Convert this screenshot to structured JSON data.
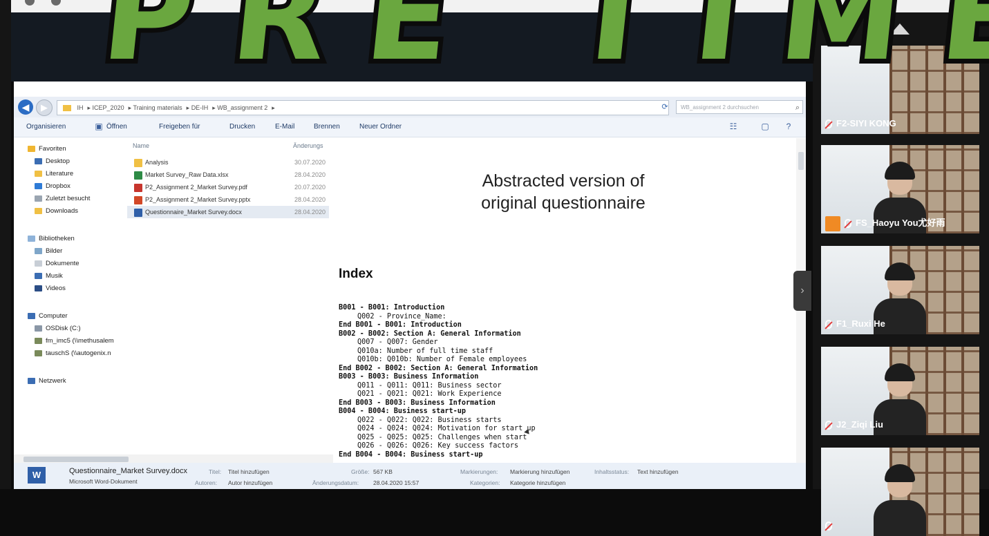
{
  "overlay": {
    "title": "PRE TIME"
  },
  "explorer": {
    "address": {
      "crumbs": [
        "IH",
        "ICEP_2020",
        "Training materials",
        "DE-IH",
        "WB_assignment 2"
      ],
      "search_placeholder": "WB_assignment 2 durchsuchen"
    },
    "toolbar": [
      "Organisieren",
      "Öffnen",
      "Freigeben für",
      "Drucken",
      "E-Mail",
      "Brennen",
      "Neuer Ordner"
    ],
    "nav": {
      "favorites": {
        "label": "Favoriten",
        "items": [
          "Desktop",
          "Literature",
          "Dropbox",
          "Zuletzt besucht",
          "Downloads"
        ]
      },
      "libraries": {
        "label": "Bibliotheken",
        "items": [
          "Bilder",
          "Dokumente",
          "Musik",
          "Videos"
        ]
      },
      "computer": {
        "label": "Computer",
        "items": [
          "OSDisk (C:)",
          "fm_imc5 (\\\\methusalem",
          "tauschS (\\\\autogenix.n"
        ]
      },
      "network": {
        "label": "Netzwerk"
      }
    },
    "columns": {
      "name": "Name",
      "date": "Änderungs"
    },
    "files": [
      {
        "name": "Analysis",
        "date": "30.07.2020",
        "color": "#f0c044"
      },
      {
        "name": "Market Survey_Raw Data.xlsx",
        "date": "28.04.2020",
        "color": "#2e8b46"
      },
      {
        "name": "P2_Assignment 2_Market Survey.pdf",
        "date": "20.07.2020",
        "color": "#c7352d"
      },
      {
        "name": "P2_Assignment 2_Market Survey.pptx",
        "date": "28.04.2020",
        "color": "#d24726"
      },
      {
        "name": "Questionnaire_Market Survey.docx",
        "date": "28.04.2020",
        "color": "#2f5fa8"
      }
    ],
    "preview": {
      "heading": "Abstracted version of\noriginal questionnaire",
      "index_title": "Index",
      "lines": [
        {
          "text": "B001 - B001: Introduction",
          "kind": "sec"
        },
        {
          "text": "Q002 - Province_Name:",
          "kind": "sub"
        },
        {
          "text": "End B001 - B001: Introduction",
          "kind": "sec"
        },
        {
          "text": "B002 - B002: Section A: General Information",
          "kind": "sec"
        },
        {
          "text": "Q007 - Q007: Gender",
          "kind": "sub"
        },
        {
          "text": "Q010a: Number of full time staff",
          "kind": "sub"
        },
        {
          "text": "Q010b: Q010b: Number of Female employees",
          "kind": "sub"
        },
        {
          "text": "End B002 - B002: Section A: General Information",
          "kind": "sec"
        },
        {
          "text": "B003 - B003: Business Information",
          "kind": "sec"
        },
        {
          "text": "Q011 - Q011: Q011: Business sector",
          "kind": "sub"
        },
        {
          "text": "Q021 - Q021: Q021: Work Experience",
          "kind": "sub"
        },
        {
          "text": "End B003 - B003: Business Information",
          "kind": "sec"
        },
        {
          "text": "B004 - B004: Business start-up",
          "kind": "sec"
        },
        {
          "text": "Q022 - Q022: Q022: Business starts",
          "kind": "sub"
        },
        {
          "text": "Q024 - Q024: Q024: Motivation for start up",
          "kind": "sub"
        },
        {
          "text": "Q025 - Q025: Q025: Challenges when start",
          "kind": "sub"
        },
        {
          "text": "Q026 - Q026: Q026: Key success factors",
          "kind": "sub"
        },
        {
          "text": "End B004 - B004: Business start-up",
          "kind": "sec"
        }
      ]
    },
    "details": {
      "file_name": "Questionnaire_Market Survey.docx",
      "file_type": "Microsoft Word-Dokument",
      "title_key": "Titel:",
      "title_val": "Titel hinzufügen",
      "authors_key": "Autoren:",
      "authors_val": "Autor hinzufügen",
      "size_key": "Größe:",
      "size_val": "567 KB",
      "changed_key": "Änderungsdatum:",
      "changed_val": "28.04.2020 15:57",
      "tags_key": "Markierungen:",
      "tags_val": "Markierung hinzufügen",
      "status_key": "Inhaltsstatus:",
      "status_val": "Text hinzufügen",
      "category_key": "Kategorien:",
      "category_val": "Kategorie hinzufügen"
    }
  },
  "participants": [
    {
      "name": "F2-SIYI KONG",
      "person": false,
      "badge": false
    },
    {
      "name": "FS_Haoyu You尤好雨",
      "person": true,
      "badge": true
    },
    {
      "name": "F1_Ruxi He",
      "person": true,
      "badge": false
    },
    {
      "name": "J2_Ziqi Liu",
      "person": true,
      "badge": false
    },
    {
      "name": "",
      "person": true,
      "badge": false
    }
  ],
  "colors": {
    "accent_green": "#6aa73f",
    "word_blue": "#2f5fa8",
    "dark_band": "#141a22"
  }
}
